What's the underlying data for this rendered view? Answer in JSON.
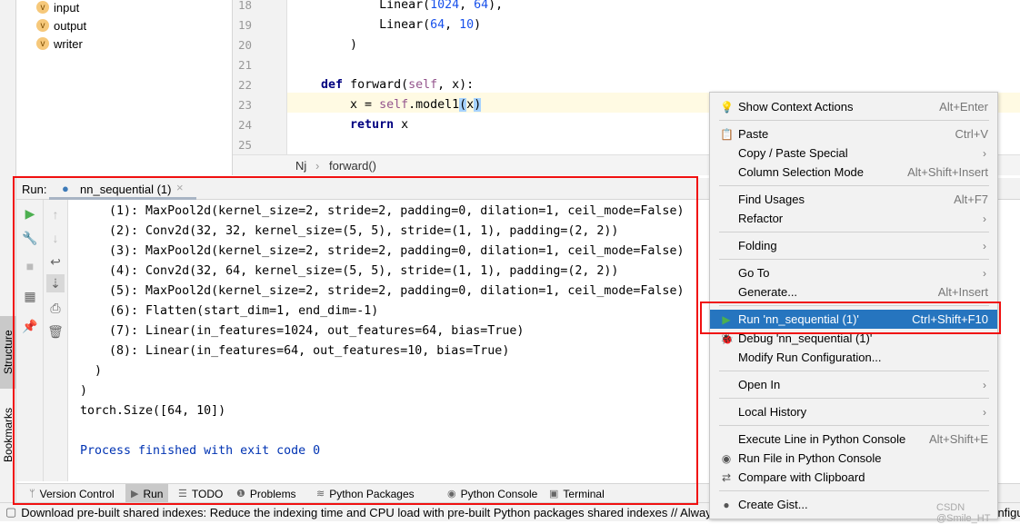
{
  "project": {
    "items": [
      {
        "label": "input"
      },
      {
        "label": "output"
      },
      {
        "label": "writer"
      }
    ],
    "badge": "v"
  },
  "editor": {
    "lines": [
      {
        "num": "18",
        "tokens": [
          {
            "t": "            Linear(",
            "k": "plain"
          },
          {
            "t": "1024",
            "k": "num"
          },
          {
            "t": ", ",
            "k": "plain"
          },
          {
            "t": "64",
            "k": "num"
          },
          {
            "t": "),",
            "k": "plain"
          }
        ]
      },
      {
        "num": "19",
        "tokens": [
          {
            "t": "            Linear(",
            "k": "plain"
          },
          {
            "t": "64",
            "k": "num"
          },
          {
            "t": ", ",
            "k": "plain"
          },
          {
            "t": "10",
            "k": "num"
          },
          {
            "t": ")",
            "k": "plain"
          }
        ]
      },
      {
        "num": "20",
        "tokens": [
          {
            "t": "        )",
            "k": "plain"
          }
        ]
      },
      {
        "num": "21",
        "tokens": []
      },
      {
        "num": "22",
        "tokens": [
          {
            "t": "    ",
            "k": "plain"
          },
          {
            "t": "def",
            "k": "kw"
          },
          {
            "t": " forward(",
            "k": "plain"
          },
          {
            "t": "self",
            "k": "self"
          },
          {
            "t": ", x):",
            "k": "plain"
          }
        ]
      },
      {
        "num": "23",
        "tokens": [
          {
            "t": "        x = ",
            "k": "plain"
          },
          {
            "t": "self",
            "k": "self"
          },
          {
            "t": ".model1",
            "k": "plain"
          },
          {
            "t": "(",
            "k": "hl"
          },
          {
            "t": "x",
            "k": "plain"
          },
          {
            "t": ")",
            "k": "hl"
          }
        ]
      },
      {
        "num": "24",
        "tokens": [
          {
            "t": "        ",
            "k": "plain"
          },
          {
            "t": "return",
            "k": "kw"
          },
          {
            "t": " x",
            "k": "plain"
          }
        ]
      },
      {
        "num": "25",
        "tokens": []
      }
    ],
    "current_line": "23",
    "breadcrumb": [
      "Nj",
      "forward()"
    ]
  },
  "run": {
    "label": "Run:",
    "tab": "nn_sequential (1)",
    "close": "×",
    "console": [
      "    (1): MaxPool2d(kernel_size=2, stride=2, padding=0, dilation=1, ceil_mode=False)",
      "    (2): Conv2d(32, 32, kernel_size=(5, 5), stride=(1, 1), padding=(2, 2))",
      "    (3): MaxPool2d(kernel_size=2, stride=2, padding=0, dilation=1, ceil_mode=False)",
      "    (4): Conv2d(32, 64, kernel_size=(5, 5), stride=(1, 1), padding=(2, 2))",
      "    (5): MaxPool2d(kernel_size=2, stride=2, padding=0, dilation=1, ceil_mode=False)",
      "    (6): Flatten(start_dim=1, end_dim=-1)",
      "    (7): Linear(in_features=1024, out_features=64, bias=True)",
      "    (8): Linear(in_features=64, out_features=10, bias=True)",
      "  )",
      ")",
      "torch.Size([64, 10])",
      "",
      "Process finished with exit code 0"
    ]
  },
  "side_tabs": {
    "structure": "Structure",
    "bookmarks": "Bookmarks"
  },
  "toolwindows": [
    {
      "label": "Version Control",
      "icon": "branch-icon"
    },
    {
      "label": "Run",
      "icon": "play-icon",
      "active": true
    },
    {
      "label": "TODO",
      "icon": "list-icon"
    },
    {
      "label": "Problems",
      "icon": "alert-icon"
    },
    {
      "label": "Python Packages",
      "icon": "layers-icon"
    },
    {
      "label": "Python Console",
      "icon": "python-icon"
    },
    {
      "label": "Terminal",
      "icon": "terminal-icon"
    }
  ],
  "status": "Download pre-built shared indexes: Reduce the indexing time and CPU load with pre-built Python packages shared indexes // Always download // Download once // Don't show again // Configure...",
  "menu": {
    "items": [
      {
        "label": "Show Context Actions",
        "shortcut": "Alt+Enter",
        "icon": "lightbulb-icon"
      },
      {
        "sep": true
      },
      {
        "label": "Paste",
        "shortcut": "Ctrl+V",
        "icon": "clipboard-icon"
      },
      {
        "label": "Copy / Paste Special",
        "submenu": true
      },
      {
        "label": "Column Selection Mode",
        "shortcut": "Alt+Shift+Insert"
      },
      {
        "sep": true
      },
      {
        "label": "Find Usages",
        "shortcut": "Alt+F7"
      },
      {
        "label": "Refactor",
        "submenu": true
      },
      {
        "sep": true
      },
      {
        "label": "Folding",
        "submenu": true
      },
      {
        "sep": true
      },
      {
        "label": "Go To",
        "submenu": true
      },
      {
        "label": "Generate...",
        "shortcut": "Alt+Insert"
      },
      {
        "sep": true
      },
      {
        "label": "Run 'nn_sequential (1)'",
        "shortcut": "Ctrl+Shift+F10",
        "icon": "run-icon",
        "selected": true
      },
      {
        "label": "Debug 'nn_sequential (1)'",
        "icon": "bug-icon"
      },
      {
        "label": "Modify Run Configuration..."
      },
      {
        "sep": true
      },
      {
        "label": "Open In",
        "submenu": true
      },
      {
        "sep": true
      },
      {
        "label": "Local History",
        "submenu": true
      },
      {
        "sep": true
      },
      {
        "label": "Execute Line in Python Console",
        "shortcut": "Alt+Shift+E"
      },
      {
        "label": "Run File in Python Console",
        "icon": "python-icon"
      },
      {
        "label": "Compare with Clipboard",
        "icon": "compare-icon"
      },
      {
        "sep": true
      },
      {
        "label": "Create Gist...",
        "icon": "github-icon"
      }
    ]
  },
  "watermark": "CSDN @Smile_HT",
  "colors": {
    "highlight": "#2675bf",
    "annotation": "#f01010",
    "run_green": "#4caf50",
    "exit_text": "#0033b3"
  }
}
